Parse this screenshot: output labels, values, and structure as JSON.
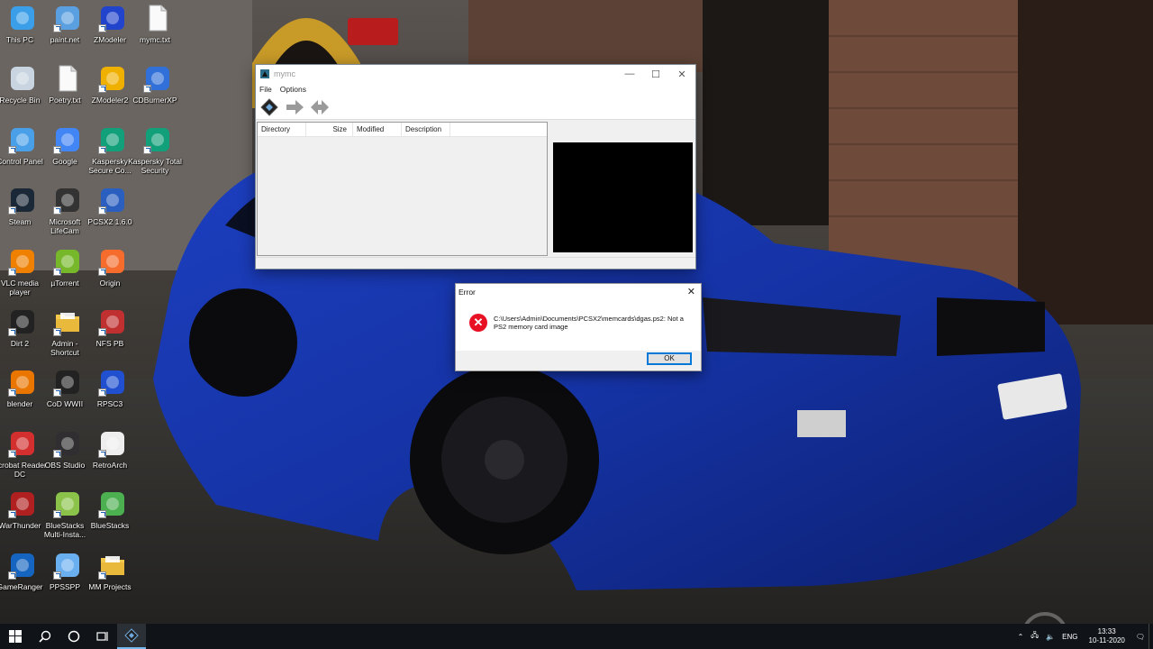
{
  "desktop": {
    "icons": [
      {
        "label": "This PC",
        "icon": "computer-icon",
        "color": "#3a9ee8"
      },
      {
        "label": "paint.net",
        "icon": "paintnet-icon",
        "color": "#5aa0e0"
      },
      {
        "label": "ZModeler",
        "icon": "zmodeler-icon",
        "color": "#2244cc"
      },
      {
        "label": "mymc.txt",
        "icon": "text-file-icon",
        "color": "#f2f2f2"
      },
      {
        "label": "Recycle Bin",
        "icon": "recycle-bin-icon",
        "color": "#c8d4e0"
      },
      {
        "label": "Poetry.txt",
        "icon": "text-file-icon",
        "color": "#f2f2f2"
      },
      {
        "label": "ZModeler2",
        "icon": "zmodeler2-icon",
        "color": "#f0b000"
      },
      {
        "label": "CDBurnerXP",
        "icon": "cdburnerxp-icon",
        "color": "#3070d8"
      },
      {
        "label": "Control Panel",
        "icon": "control-panel-icon",
        "color": "#4aa0e8"
      },
      {
        "label": "Google",
        "icon": "chrome-icon",
        "color": "#4285f4"
      },
      {
        "label": "Kaspersky Secure Co...",
        "icon": "kaspersky-vpn-icon",
        "color": "#11a07a"
      },
      {
        "label": "Kaspersky Total Security",
        "icon": "kaspersky-icon",
        "color": "#11a07a"
      },
      {
        "label": "Steam",
        "icon": "steam-icon",
        "color": "#1b2838"
      },
      {
        "label": "Microsoft LifeCam",
        "icon": "lifecam-icon",
        "color": "#333333"
      },
      {
        "label": "PCSX2 1.6.0",
        "icon": "pcsx2-icon",
        "color": "#2a5fc0"
      },
      {
        "label": "VLC media player",
        "icon": "vlc-icon",
        "color": "#f08000"
      },
      {
        "label": "µTorrent",
        "icon": "utorrent-icon",
        "color": "#76b82a"
      },
      {
        "label": "Origin",
        "icon": "origin-icon",
        "color": "#f56c2d"
      },
      {
        "label": "Dirt 2",
        "icon": "dirt2-icon",
        "color": "#222222"
      },
      {
        "label": "Admin - Shortcut",
        "icon": "folder-icon",
        "color": "#f2c94c"
      },
      {
        "label": "NFS PB",
        "icon": "nfs-icon",
        "color": "#c03030"
      },
      {
        "label": "blender",
        "icon": "blender-icon",
        "color": "#ea7600"
      },
      {
        "label": "CoD WWII",
        "icon": "cod-icon",
        "color": "#222222"
      },
      {
        "label": "RPSC3",
        "icon": "rpcs3-icon",
        "color": "#2050d0"
      },
      {
        "label": "Acrobat Reader DC",
        "icon": "acrobat-icon",
        "color": "#d32f2f"
      },
      {
        "label": "OBS Studio",
        "icon": "obs-icon",
        "color": "#302e31"
      },
      {
        "label": "RetroArch",
        "icon": "retroarch-icon",
        "color": "#eeeeee"
      },
      {
        "label": "WarThunder",
        "icon": "warthunder-icon",
        "color": "#b02020"
      },
      {
        "label": "BlueStacks Multi-Insta...",
        "icon": "bluestacks-multi-icon",
        "color": "#8bc34a"
      },
      {
        "label": "BlueStacks",
        "icon": "bluestacks-icon",
        "color": "#4caf50"
      },
      {
        "label": "GameRanger",
        "icon": "gameranger-icon",
        "color": "#1565c0"
      },
      {
        "label": "PPSSPP",
        "icon": "ppsspp-icon",
        "color": "#6ab0f0"
      },
      {
        "label": "MM Projects",
        "icon": "folder-icon",
        "color": "#f2c94c"
      }
    ]
  },
  "mymc": {
    "title": "mymc",
    "menu": [
      "File",
      "Options"
    ],
    "columns": [
      "Directory",
      "Size",
      "Modified",
      "Description"
    ]
  },
  "error_dialog": {
    "title": "Error",
    "message": "C:\\Users\\Admin\\Documents\\PCSX2\\memcards\\dgas.ps2: Not a PS2 memory card image",
    "ok_label": "OK"
  },
  "taskbar": {
    "language": "ENG",
    "time": "13:33",
    "date": "10-11-2020"
  },
  "colors": {
    "accent": "#0078d7",
    "error": "#e81123",
    "taskbar": "#101317"
  }
}
